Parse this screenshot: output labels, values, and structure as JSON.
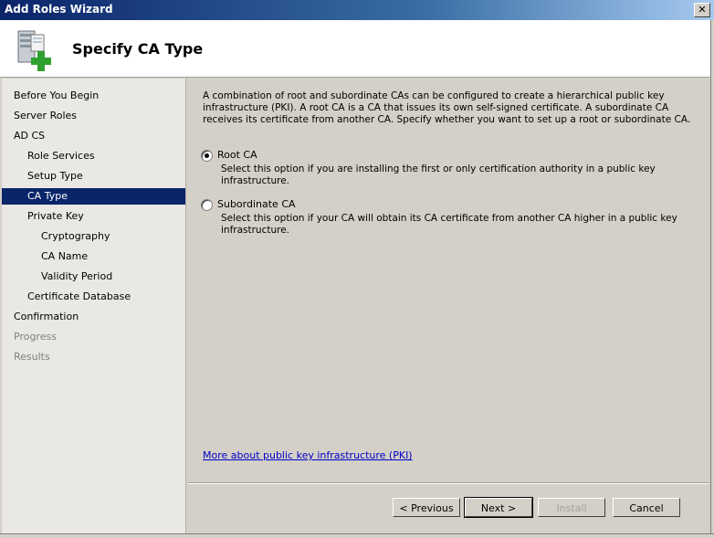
{
  "window": {
    "title": "Add Roles Wizard",
    "close_glyph": "✕"
  },
  "header": {
    "title": "Specify CA Type",
    "icon": "server-add-icon"
  },
  "nav": {
    "items": [
      {
        "label": "Before You Begin",
        "state": "normal"
      },
      {
        "label": "Server Roles",
        "state": "normal"
      },
      {
        "label": "AD CS",
        "state": "normal"
      },
      {
        "label": "Role Services",
        "state": "normal"
      },
      {
        "label": "Setup Type",
        "state": "normal"
      },
      {
        "label": "CA Type",
        "state": "selected"
      },
      {
        "label": "Private Key",
        "state": "normal"
      },
      {
        "label": "Cryptography",
        "state": "normal"
      },
      {
        "label": "CA Name",
        "state": "normal"
      },
      {
        "label": "Validity Period",
        "state": "normal"
      },
      {
        "label": "Certificate Database",
        "state": "normal"
      },
      {
        "label": "Confirmation",
        "state": "normal"
      },
      {
        "label": "Progress",
        "state": "disabled"
      },
      {
        "label": "Results",
        "state": "disabled"
      }
    ]
  },
  "main": {
    "description": "A combination of root and subordinate CAs can be configured to create a hierarchical public key infrastructure (PKI). A root CA is a CA that issues its own self-signed certificate. A subordinate CA receives its certificate from another CA. Specify whether you want to set up a root or subordinate CA.",
    "options": [
      {
        "label": "Root CA",
        "description": "Select this option if you are installing the first or only certification authority in a public key infrastructure.",
        "checked": true
      },
      {
        "label": "Subordinate CA",
        "description": "Select this option if your CA will obtain its CA certificate from another CA higher in a public key infrastructure.",
        "checked": false
      }
    ],
    "help_link": "More about public key infrastructure (PKI)"
  },
  "buttons": {
    "previous": "< Previous",
    "next": "Next >",
    "install": "Install",
    "cancel": "Cancel"
  },
  "colors": {
    "selection": "#0a246a",
    "link": "#0000c8",
    "title_bar_start": "#0a246a",
    "title_bar_end": "#a6caf0"
  }
}
